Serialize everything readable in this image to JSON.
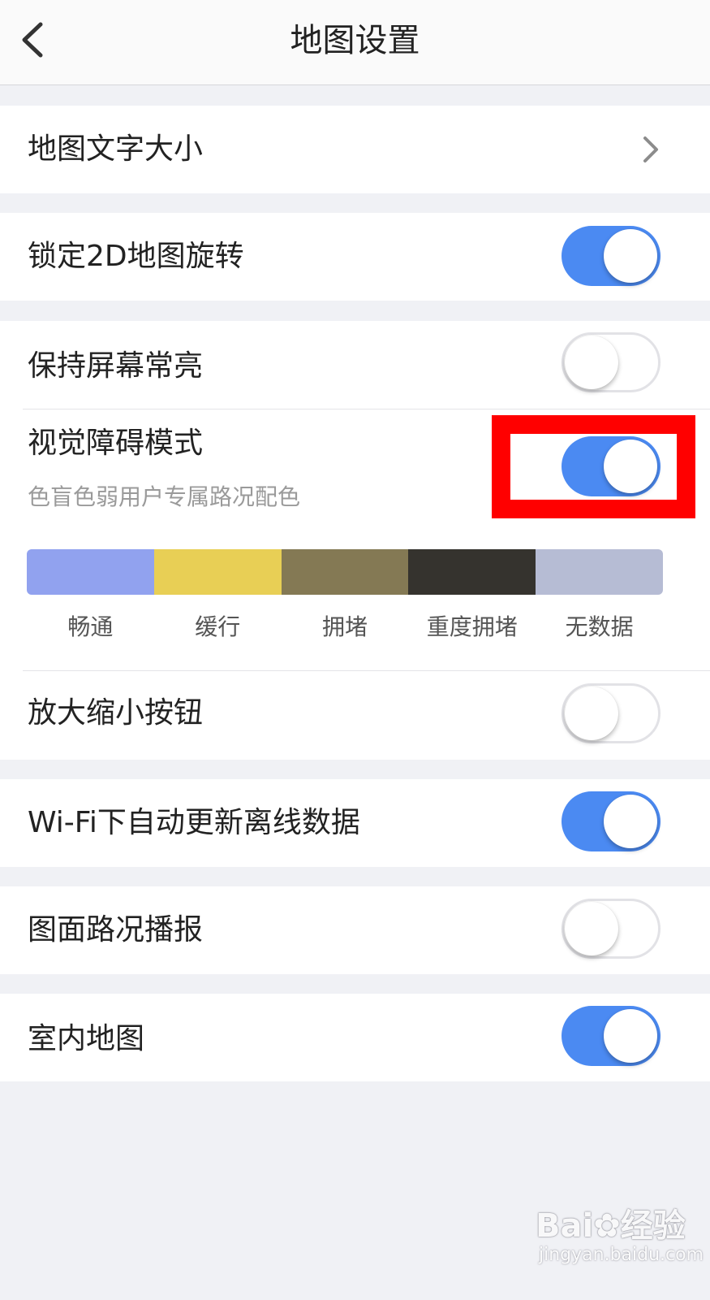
{
  "header": {
    "title": "地图设置",
    "back_icon": "chevron-left-icon"
  },
  "settings": {
    "font_size": {
      "label": "地图文字大小",
      "icon": "chevron-right-icon"
    },
    "lock_2d_rotation": {
      "label": "锁定2D地图旋转",
      "on": true
    },
    "keep_screen_on": {
      "label": "保持屏幕常亮",
      "on": false
    },
    "visual_impairment_mode": {
      "label": "视觉障碍模式",
      "sublabel": "色盲色弱用户专属路况配色",
      "on": true,
      "legend": [
        {
          "label": "畅通",
          "color": "#91a2ef"
        },
        {
          "label": "缓行",
          "color": "#e8cf55"
        },
        {
          "label": "拥堵",
          "color": "#847954"
        },
        {
          "label": "重度拥堵",
          "color": "#35332e"
        },
        {
          "label": "无数据",
          "color": "#b6bcd4"
        }
      ]
    },
    "zoom_buttons": {
      "label": "放大缩小按钮",
      "on": false
    },
    "wifi_auto_update": {
      "label": "Wi-Fi下自动更新离线数据",
      "on": true
    },
    "traffic_broadcast": {
      "label": "图面路况播报",
      "on": false
    },
    "indoor_map": {
      "label": "室内地图",
      "on": true
    }
  },
  "colors": {
    "toggle_on": "#4b8af2",
    "highlight": "#ff0000",
    "page_background": "#f0f1f5"
  },
  "watermark": {
    "brand": "Bai",
    "brand_suffix": "经验",
    "url": "jingyan.baidu.com"
  }
}
